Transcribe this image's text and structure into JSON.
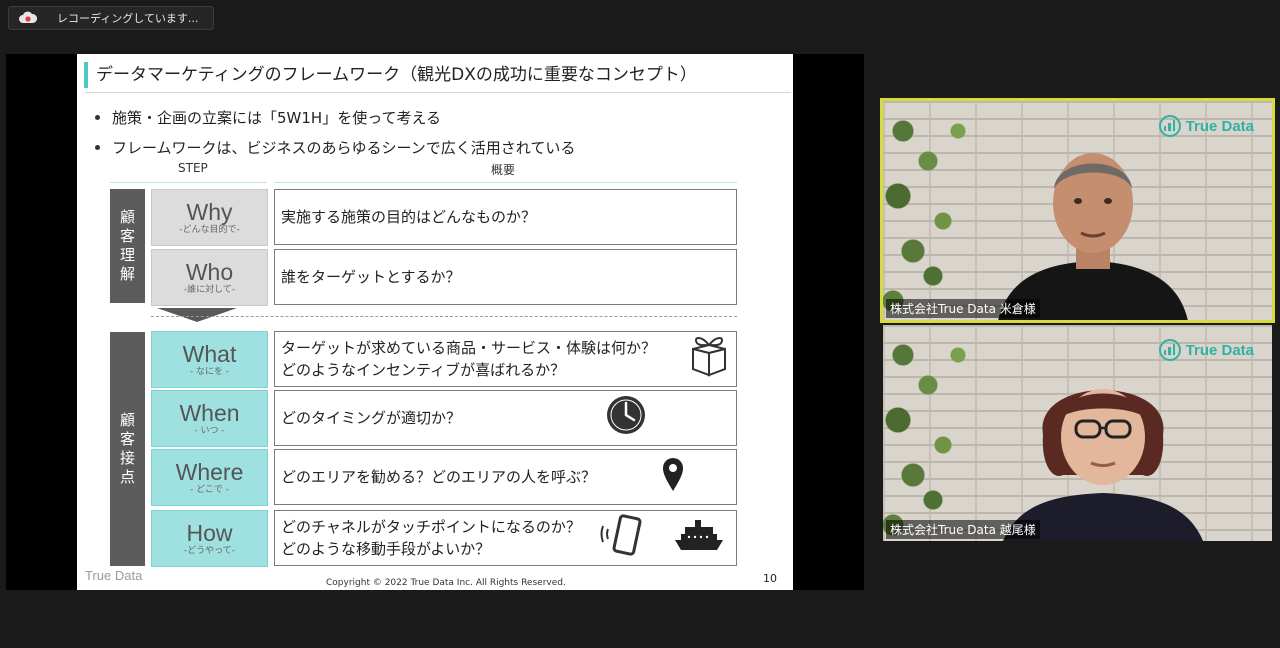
{
  "recording": {
    "label": "レコーディングしています..."
  },
  "slide": {
    "title": "データマーケティングのフレームワーク（観光DXの成功に重要なコンセプト）",
    "bullets": [
      "施策・企画の立案には「5W1H」を使って考える",
      "フレームワークは、ビジネスのあらゆるシーンで広く活用されている"
    ],
    "headers": {
      "step": "STEP",
      "summary": "概要"
    },
    "sections": [
      {
        "label": [
          "顧",
          "客",
          "理",
          "解"
        ]
      },
      {
        "label": [
          "顧",
          "客",
          "接",
          "点"
        ]
      }
    ],
    "steps": [
      {
        "en": "Why",
        "jp": "-どんな目的で-",
        "desc": [
          "実施する施策の目的はどんなものか？"
        ],
        "icon": ""
      },
      {
        "en": "Who",
        "jp": "-誰に対して-",
        "desc": [
          "誰をターゲットとするか？"
        ],
        "icon": ""
      },
      {
        "en": "What",
        "jp": "- なにを -",
        "desc": [
          "ターゲットが求めている商品・サービス・体験は何か？",
          "どのようなインセンティブが喜ばれるか？"
        ],
        "icon": "gift-box-icon"
      },
      {
        "en": "When",
        "jp": "- いつ -",
        "desc": [
          "どのタイミングが適切か？"
        ],
        "icon": "clock-icon"
      },
      {
        "en": "Where",
        "jp": "- どこで -",
        "desc": [
          "どのエリアを勧める？どのエリアの人を呼ぶ？"
        ],
        "icon": "map-pin-icon"
      },
      {
        "en": "How",
        "jp": "-どうやって-",
        "desc": [
          "どのチャネルがタッチポイントになるのか？",
          "どのような移動手段がよいか？"
        ],
        "icon": "smartphone-and-ship-icon"
      }
    ],
    "footer_brand": "True Data",
    "copyright": "Copyright © 2022 True Data Inc. All Rights Reserved.",
    "page": "10"
  },
  "participants": [
    {
      "name": "株式会社True Data  米倉様",
      "logo": "True Data",
      "active": true
    },
    {
      "name": "株式会社True Data  越尾様",
      "logo": "True Data",
      "active": false
    }
  ],
  "colors": {
    "accent": "#4cc9c4",
    "step_gray": "#dcdcdc",
    "step_teal": "#9fe1e1",
    "section": "#5c5c5c",
    "active_speaker": "#d8dc38",
    "brand": "#2fb2a6"
  }
}
